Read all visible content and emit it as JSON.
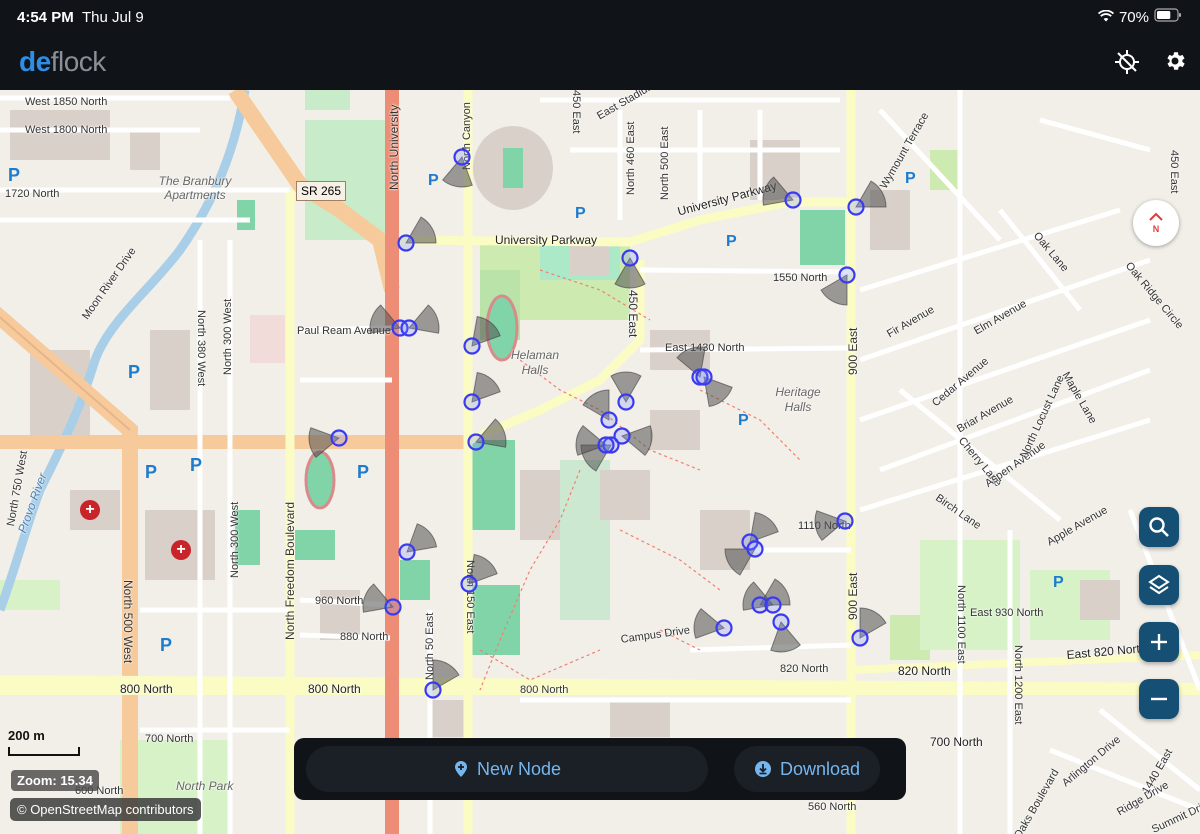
{
  "status_bar": {
    "time": "4:54 PM",
    "date": "Thu Jul 9",
    "battery_percent": "70%",
    "battery_level": 0.7
  },
  "app": {
    "logo_prefix": "de",
    "logo_suffix": "flock",
    "actions": [
      {
        "name": "gps-off-icon"
      },
      {
        "name": "gear-icon"
      }
    ]
  },
  "map": {
    "compass_label": "N",
    "controls": [
      {
        "name": "search-icon"
      },
      {
        "name": "layers-icon"
      },
      {
        "name": "plus-icon"
      },
      {
        "name": "minus-icon"
      }
    ],
    "scale_label": "200 m",
    "zoom_label": "Zoom: 15.34",
    "attribution": "© OpenStreetMap contributors",
    "labels": {
      "west_1850": "West 1850 North",
      "west_1800": "West 1800 North",
      "n_1720": "1720 North",
      "branbury": "The Branbury Apartments",
      "sr265": "SR 265",
      "north_university": "North University",
      "north_canyon": "North Canyon",
      "university_parkway": "University Parkway",
      "university_parkway2": "University Parkway",
      "n_1550": "1550 North",
      "paul_ream": "Paul Ream Avenue",
      "helaman": "Helaman Halls",
      "heritage": "Heritage Halls",
      "east_1430": "East 1430 North",
      "east_450": "450 East",
      "east_900": "900 East",
      "east_900b": "900 East",
      "moon_river": "Moon River Drive",
      "north_380": "North 380 West",
      "north_300": "North 300 West",
      "north_300b": "North 300 West",
      "north_500": "North 500 West",
      "freedom": "North Freedom Boulevard",
      "provo_river": "Provo River",
      "n_960": "960 North",
      "n_880": "880 North",
      "north_150": "North 150 East",
      "north_50": "North 50 East",
      "campus_drive": "Campus Drive",
      "n_820": "820 North",
      "n_820b": "820 North",
      "east_820": "East 820 North",
      "n_800": "800 North",
      "n_800b": "800 North",
      "n_800c": "800 North",
      "n_700": "700 North",
      "n_700b": "700 North",
      "n_600": "600 North",
      "north_park": "North Park",
      "n_560": "560 North",
      "n_1110": "1110 North",
      "east_930": "East 930 North",
      "fir": "Fir Avenue",
      "elm": "Elm Avenue",
      "cedar": "Cedar Avenue",
      "briar": "Briar Avenue",
      "cherry": "Cherry Lane",
      "aspen": "Aspen Avenue",
      "birch": "Birch Lane",
      "apple": "Apple Avenue",
      "maple": "Maple Lane",
      "oak": "Oak Lane",
      "oak_ridge": "Oak Ridge Circle",
      "wymount": "Wymount Terrace",
      "east_450n": "450 East",
      "arlington": "Arlington Drive",
      "ridge": "Ridge Drive",
      "summit": "Summit Drive",
      "oaks_blvd": "Oaks Boulevard",
      "north_1100": "North 1100 East",
      "north_1200": "North 1200 East",
      "east_1440": "1440 East",
      "north_750": "North 750 West",
      "locust": "North Locust Lane",
      "n_450e_top": "450 East",
      "east_sta": "East Stadium",
      "n_500e": "North 500 East",
      "n_460e": "North 460 East"
    }
  },
  "bottom_panel": {
    "new_node_label": "New Node",
    "download_label": "Download"
  },
  "colors": {
    "accent": "#76b6ee",
    "fab": "#154f74",
    "camera_marker": "#3a3af0"
  }
}
